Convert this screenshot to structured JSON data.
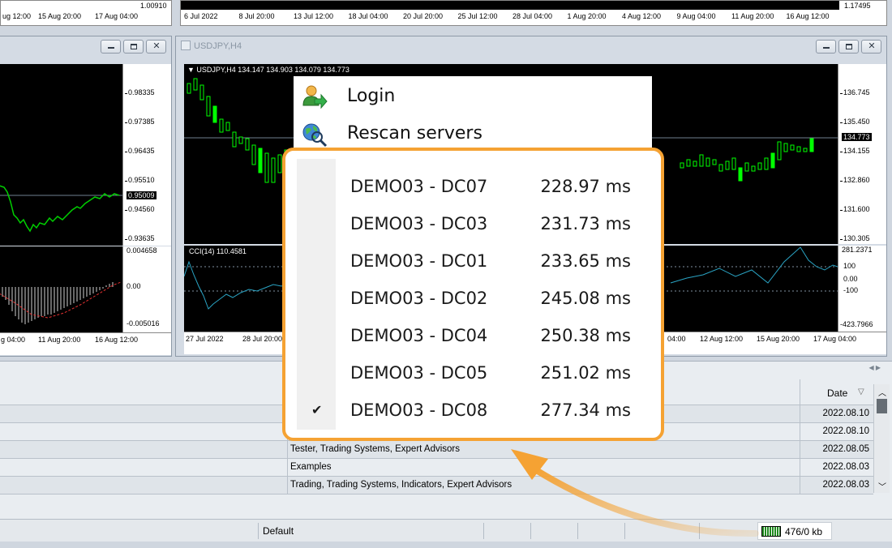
{
  "top_strip": {
    "left_price": "1.00910",
    "left_dates": [
      "ug 12:00",
      "15 Aug 20:00",
      "17 Aug 04:00"
    ],
    "right_price": "1.17495",
    "right_dates": [
      "6 Jul 2022",
      "8 Jul 20:00",
      "13 Jul 12:00",
      "18 Jul 04:00",
      "20 Jul 20:00",
      "25 Jul 12:00",
      "28 Jul 04:00",
      "1 Aug 20:00",
      "4 Aug 12:00",
      "9 Aug 04:00",
      "11 Aug 20:00",
      "16 Aug 12:00"
    ]
  },
  "left_chart": {
    "price_ticks": [
      "0.98335",
      "0.97385",
      "0.96435",
      "0.95510",
      "0.94560",
      "0.93635"
    ],
    "current_price": "0.95009",
    "indicator_ticks": [
      "0.004658",
      "0.00",
      "-0.005016"
    ],
    "dates": [
      "g 04:00",
      "11 Aug 20:00",
      "16 Aug 12:00"
    ]
  },
  "usdjpy_window": {
    "title": "USDJPY,H4",
    "info": "▼ USDJPY,H4  134.147 134.903 134.079 134.773",
    "price_ticks": [
      "136.745",
      "135.450",
      "134.155",
      "132.860",
      "131.600",
      "130.305"
    ],
    "current_price": "134.773",
    "cci_label": "CCI(14) 110.4581",
    "cci_ticks": [
      "281.2371",
      "100",
      "0.00",
      "-100",
      "-423.7966"
    ],
    "dates_left": [
      "27 Jul 2022",
      "28 Jul 20:00"
    ],
    "dates_right": [
      "04:00",
      "12 Aug 12:00",
      "15 Aug 20:00",
      "17 Aug 04:00"
    ]
  },
  "menu": {
    "items": [
      {
        "label": "Login",
        "icon": "login-user-icon"
      },
      {
        "label": "Rescan servers",
        "icon": "rescan-globe-icon"
      }
    ]
  },
  "servers": [
    {
      "name": "DEMO03 - DC07",
      "ping": "228.97 ms",
      "checked": false
    },
    {
      "name": "DEMO03 - DC03",
      "ping": "231.73 ms",
      "checked": false
    },
    {
      "name": "DEMO03 - DC01",
      "ping": "233.65 ms",
      "checked": false
    },
    {
      "name": "DEMO03 - DC02",
      "ping": "245.08 ms",
      "checked": false
    },
    {
      "name": "DEMO03 - DC04",
      "ping": "250.38 ms",
      "checked": false
    },
    {
      "name": "DEMO03 - DC05",
      "ping": "251.02 ms",
      "checked": false
    },
    {
      "name": "DEMO03 - DC08",
      "ping": "277.34 ms",
      "checked": true
    }
  ],
  "terminal": {
    "date_header": "Date",
    "rows": [
      {
        "category": "",
        "date": "2022.08.10"
      },
      {
        "category": "",
        "date": "2022.08.10"
      },
      {
        "category": "Tester, Trading Systems, Expert Advisors",
        "date": "2022.08.05"
      },
      {
        "category": "Examples",
        "date": "2022.08.03"
      },
      {
        "category": "Trading, Trading Systems, Indicators, Expert Advisors",
        "date": "2022.08.03"
      }
    ]
  },
  "statusbar": {
    "profile": "Default",
    "traffic": "476/0 kb"
  },
  "colors": {
    "accent_orange": "#f5a233",
    "bull_candle": "#00ff00",
    "chart_bg": "#000000"
  }
}
